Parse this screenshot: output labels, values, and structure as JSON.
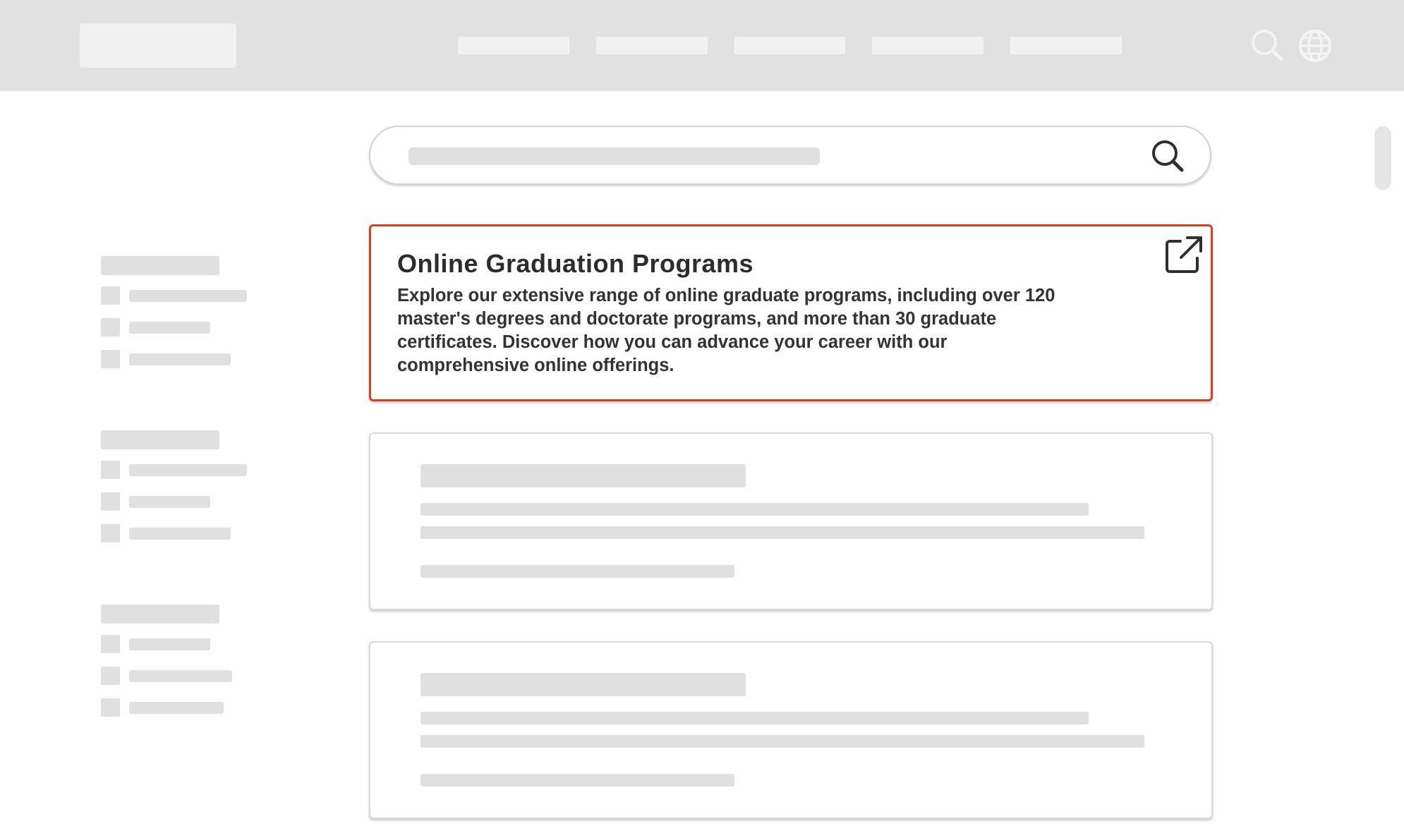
{
  "header": {
    "logo": "logo-placeholder",
    "nav_items": [
      "nav-placeholder",
      "nav-placeholder",
      "nav-placeholder",
      "nav-placeholder",
      "nav-placeholder"
    ],
    "icons": [
      "search-icon",
      "globe-icon"
    ]
  },
  "search": {
    "placeholder": "",
    "icon": "search-icon"
  },
  "featured_result": {
    "title": "Online Graduation Programs",
    "description": "Explore our extensive range of online graduate programs, including over 120 master's degrees and doctorate programs, and more than 30 graduate certificates. Discover how you can advance your career with our comprehensive online offerings.",
    "icon": "external-link-icon",
    "accent_color": "#d2421e"
  },
  "colors": {
    "header_background": "#e1e1e1",
    "placeholder": "#e0e0e0",
    "highlight_border": "#d2421e"
  }
}
